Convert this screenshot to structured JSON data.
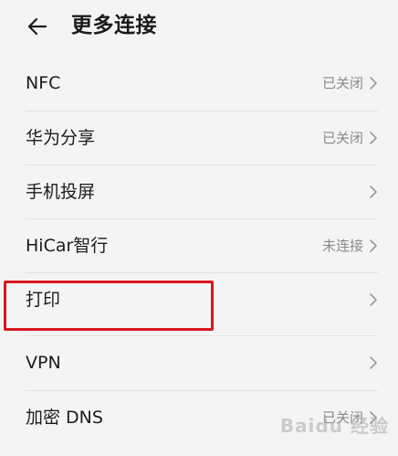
{
  "header": {
    "title": "更多连接",
    "back_icon": "arrow-left-icon"
  },
  "items": [
    {
      "label": "NFC",
      "status": "已关闭"
    },
    {
      "label": "华为分享",
      "status": "已关闭"
    },
    {
      "label": "手机投屏",
      "status": ""
    },
    {
      "label": "HiCar智行",
      "status": "未连接"
    },
    {
      "label": "打印",
      "status": ""
    },
    {
      "label": "VPN",
      "status": ""
    },
    {
      "label": "加密 DNS",
      "status": "已关闭"
    }
  ],
  "chevron_icon": "chevron-right-icon",
  "annotation": {
    "color": "#d8161f"
  },
  "watermark": "Baidu 经验"
}
